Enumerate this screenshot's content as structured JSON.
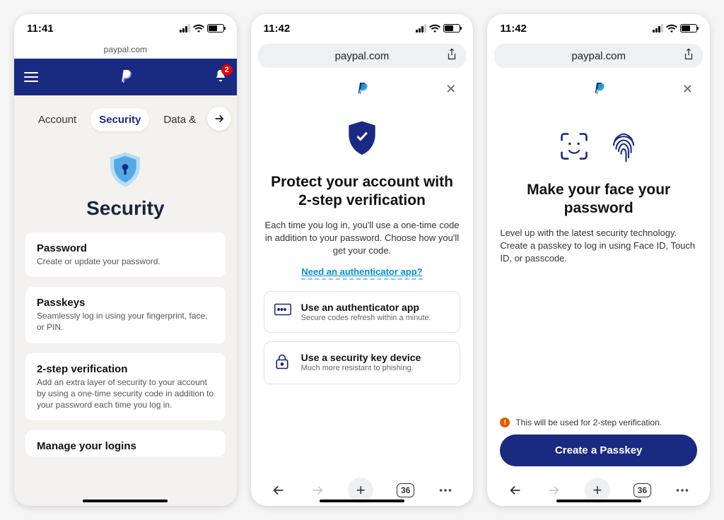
{
  "colors": {
    "primary": "#1a2a80",
    "shield_blue": "#54a8e4",
    "accent_link": "#048ecf"
  },
  "screen1": {
    "time": "11:41",
    "url": "paypal.com",
    "notification_count": "2",
    "tabs": [
      "Account",
      "Security",
      "Data & "
    ],
    "page_title": "Security",
    "cards": [
      {
        "title": "Password",
        "desc": "Create or update your password."
      },
      {
        "title": "Passkeys",
        "desc": "Seamlessly log in using your fingerprint, face, or PIN."
      },
      {
        "title": "2-step verification",
        "desc": "Add an extra layer of security to your account by using a one-time security code in addition to your password each time you log in."
      },
      {
        "title": "Manage your logins",
        "desc": ""
      }
    ]
  },
  "screen2": {
    "time": "11:42",
    "url": "paypal.com",
    "title": "Protect your account with 2-step verification",
    "sub": "Each time you log in, you'll use a one-time code in addition to your password. Choose how you'll get your code.",
    "link": "Need an authenticator app?",
    "options": [
      {
        "title": "Use an authenticator app",
        "desc": "Secure codes refresh within a minute."
      },
      {
        "title": "Use a security key device",
        "desc": "Much more resistant to phishing."
      }
    ],
    "tab_count": "36"
  },
  "screen3": {
    "time": "11:42",
    "url": "paypal.com",
    "title": "Make your face your password",
    "sub": "Level up with the latest security technology. Create a passkey to log in using Face ID, Touch ID, or passcode.",
    "note": "This will be used for 2-step verification.",
    "cta": "Create a Passkey",
    "tab_count": "36"
  }
}
